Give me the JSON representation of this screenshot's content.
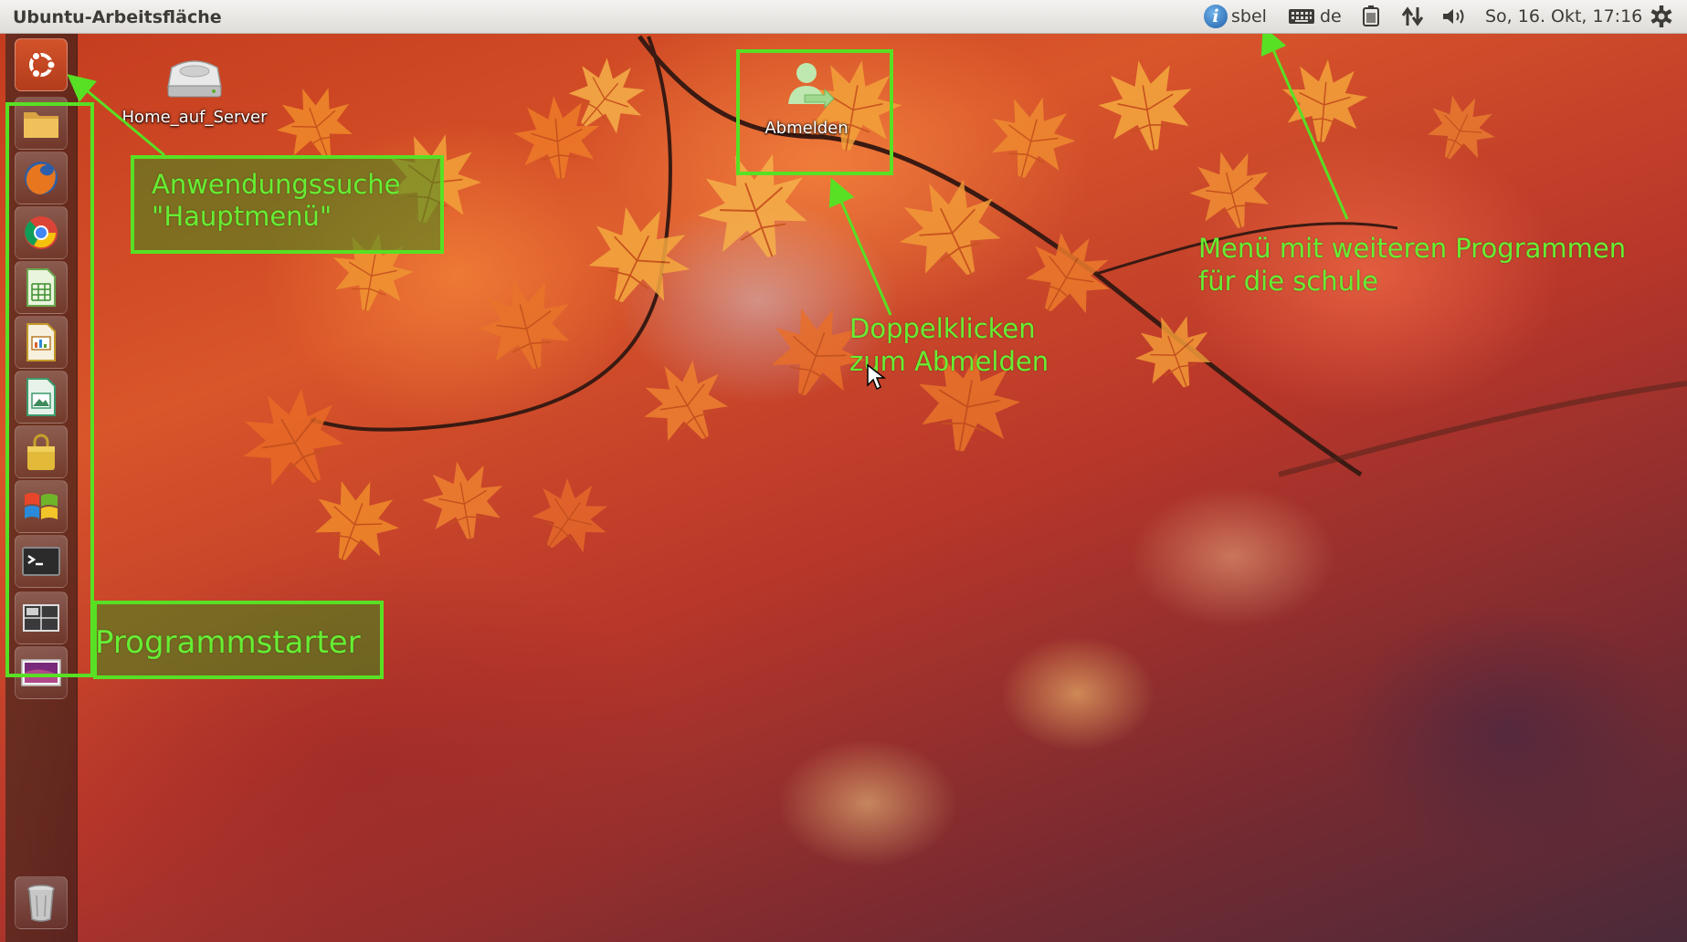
{
  "topbar": {
    "app_title": "Ubuntu-Arbeitsfläche",
    "user_label": "sbel",
    "keyboard_layout": "de",
    "datetime": "So, 16. Okt, 17:16",
    "icons": [
      "info-icon",
      "keyboard-icon",
      "battery-icon",
      "network-icon",
      "volume-icon",
      "gear-icon"
    ]
  },
  "launcher": {
    "items": [
      {
        "name": "dash-home",
        "icon": "ubuntu-logo-icon"
      },
      {
        "name": "files",
        "icon": "folder-icon"
      },
      {
        "name": "firefox",
        "icon": "firefox-icon"
      },
      {
        "name": "chromium",
        "icon": "chrome-icon"
      },
      {
        "name": "calc",
        "icon": "spreadsheet-icon"
      },
      {
        "name": "impress",
        "icon": "presentation-icon"
      },
      {
        "name": "draw",
        "icon": "drawing-icon"
      },
      {
        "name": "software-center",
        "icon": "shopping-bag-icon"
      },
      {
        "name": "windows",
        "icon": "windows-icon"
      },
      {
        "name": "terminal",
        "icon": "terminal-icon"
      },
      {
        "name": "workspace-switcher",
        "icon": "workspace-icon"
      },
      {
        "name": "desktop",
        "icon": "display-icon"
      },
      {
        "name": "trash",
        "icon": "trash-icon"
      }
    ]
  },
  "desktop_icons": {
    "home_server": "Home_auf_Server",
    "logout": "Abmelden"
  },
  "annotations": {
    "app_search": [
      "Anwendungssuche",
      "\"Hauptmenü\""
    ],
    "launcher": "Programmstarter",
    "logout": [
      "Doppelklicken",
      "zum Abmelden"
    ],
    "menu": [
      "Menü mit weiteren Programmen",
      "für die schule"
    ]
  },
  "colors": {
    "annotation_green": "#58e024",
    "panel_bg": "#e8e6e3",
    "dash_orange": "#c8461f"
  }
}
